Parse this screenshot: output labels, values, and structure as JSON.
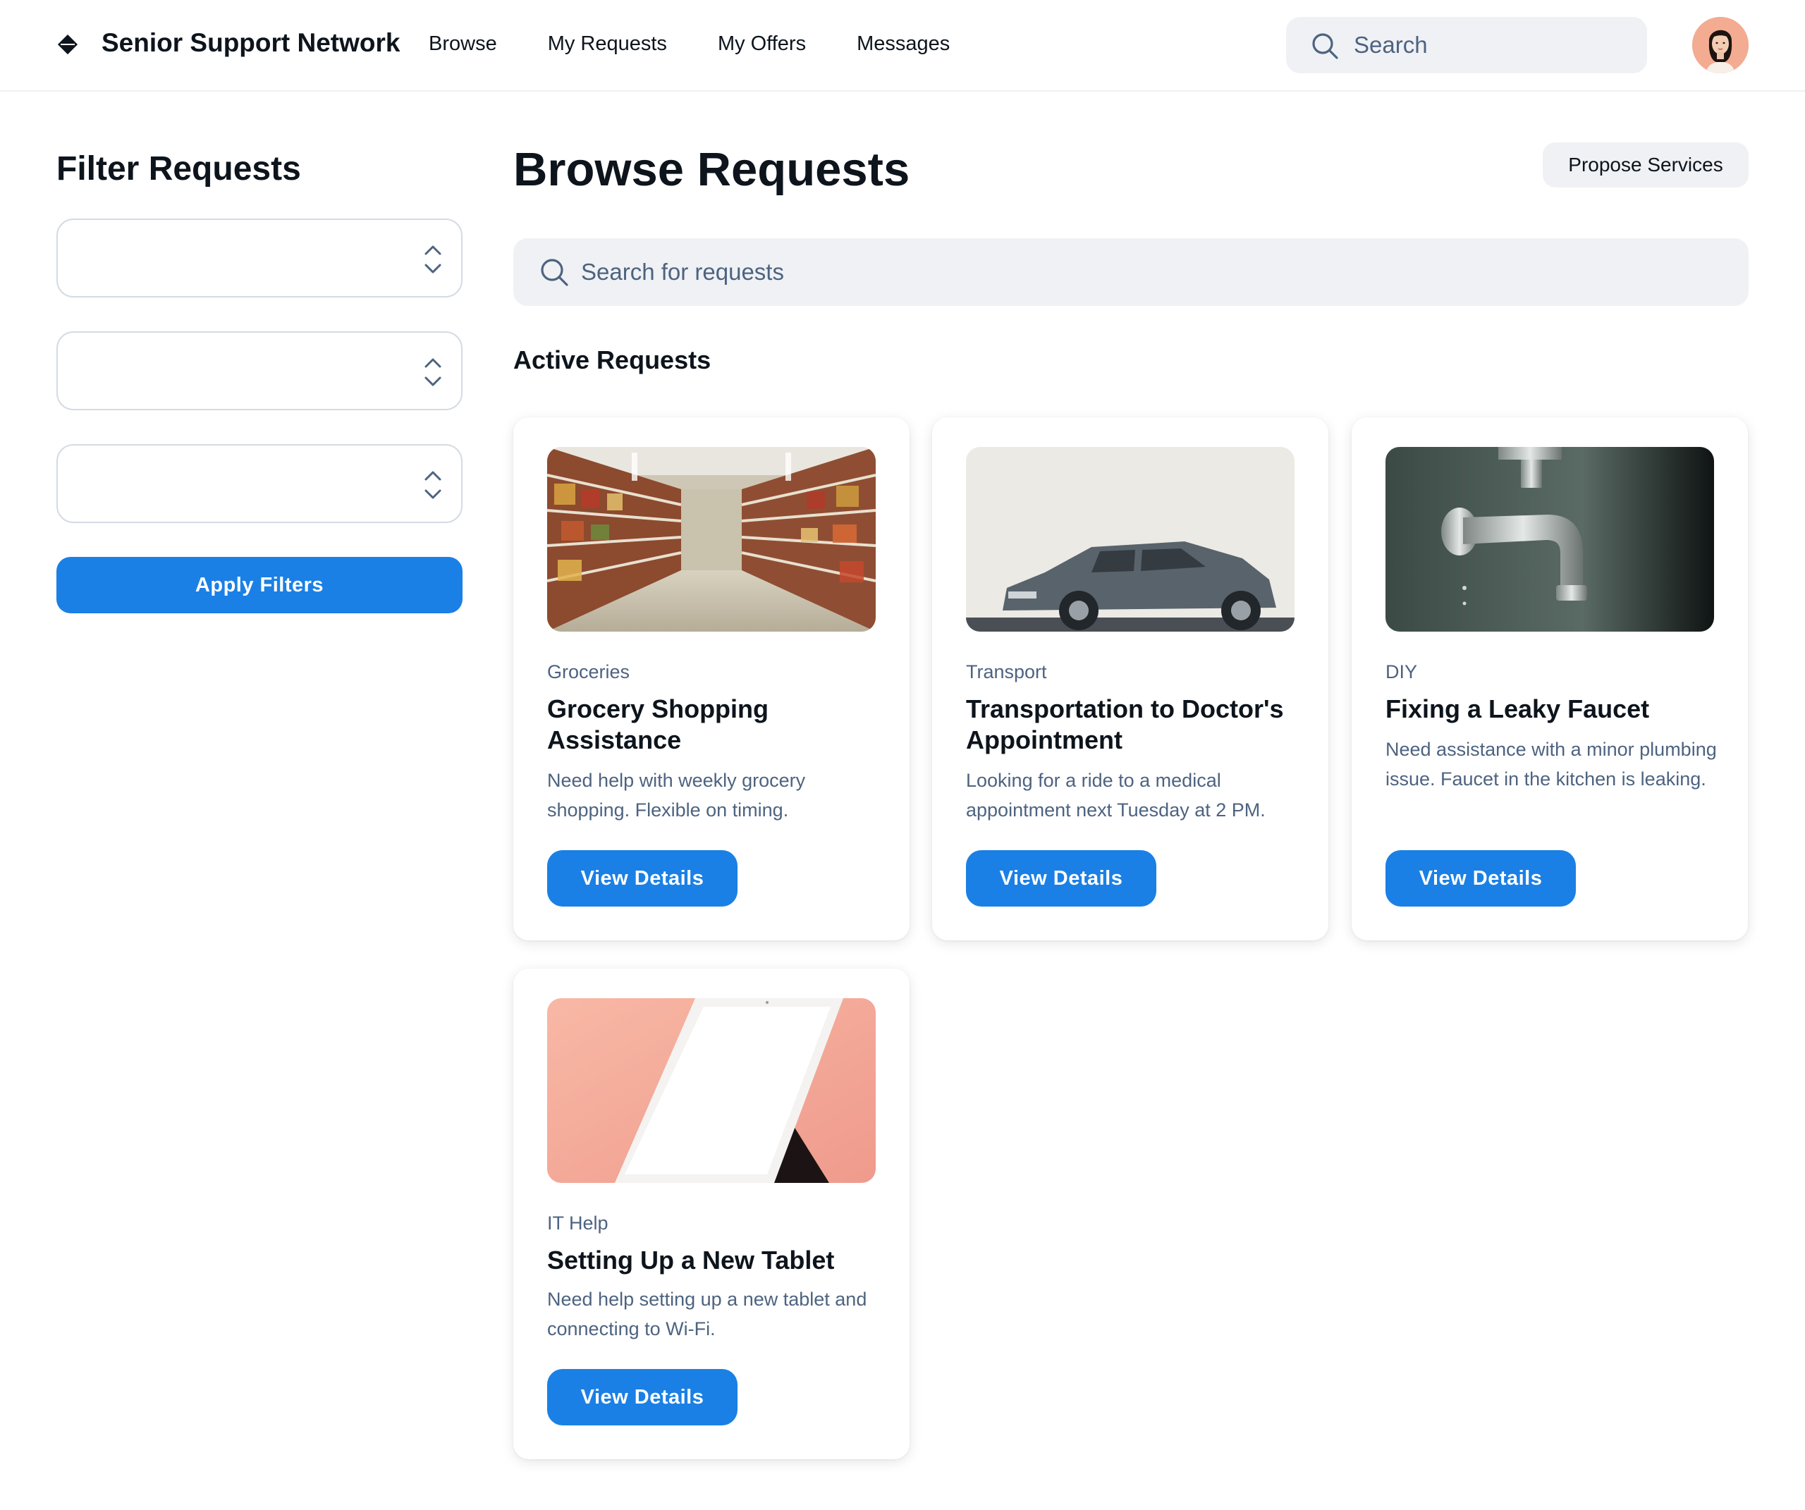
{
  "header": {
    "brand": "Senior Support Network",
    "nav": [
      "Browse",
      "My Requests",
      "My Offers",
      "Messages"
    ],
    "search_placeholder": "Search"
  },
  "sidebar": {
    "title": "Filter Requests",
    "selects": [
      "",
      "",
      ""
    ],
    "apply_label": "Apply Filters"
  },
  "main": {
    "title": "Browse Requests",
    "propose_label": "Propose Services",
    "search_placeholder": "Search for requests",
    "section_title": "Active Requests",
    "cards": [
      {
        "category": "Groceries",
        "title": "Grocery Shopping Assistance",
        "description": "Need help with weekly grocery shopping. Flexible on timing.",
        "button": "View Details"
      },
      {
        "category": "Transport",
        "title": "Transportation to Doctor's Appointment",
        "description": "Looking for a ride to a medical appointment next Tuesday at 2 PM.",
        "button": "View Details"
      },
      {
        "category": "DIY",
        "title": "Fixing a Leaky Faucet",
        "description": "Need assistance with a minor plumbing issue. Faucet in the kitchen is leaking.",
        "button": "View Details"
      },
      {
        "category": "IT Help",
        "title": "Setting Up a New Tablet",
        "description": "Need help setting up a new tablet and connecting to Wi-Fi.",
        "button": "View Details"
      }
    ]
  },
  "colors": {
    "primary": "#1a80e5",
    "text": "#0d141c",
    "muted": "#4d6380",
    "surface": "#eff1f4"
  }
}
